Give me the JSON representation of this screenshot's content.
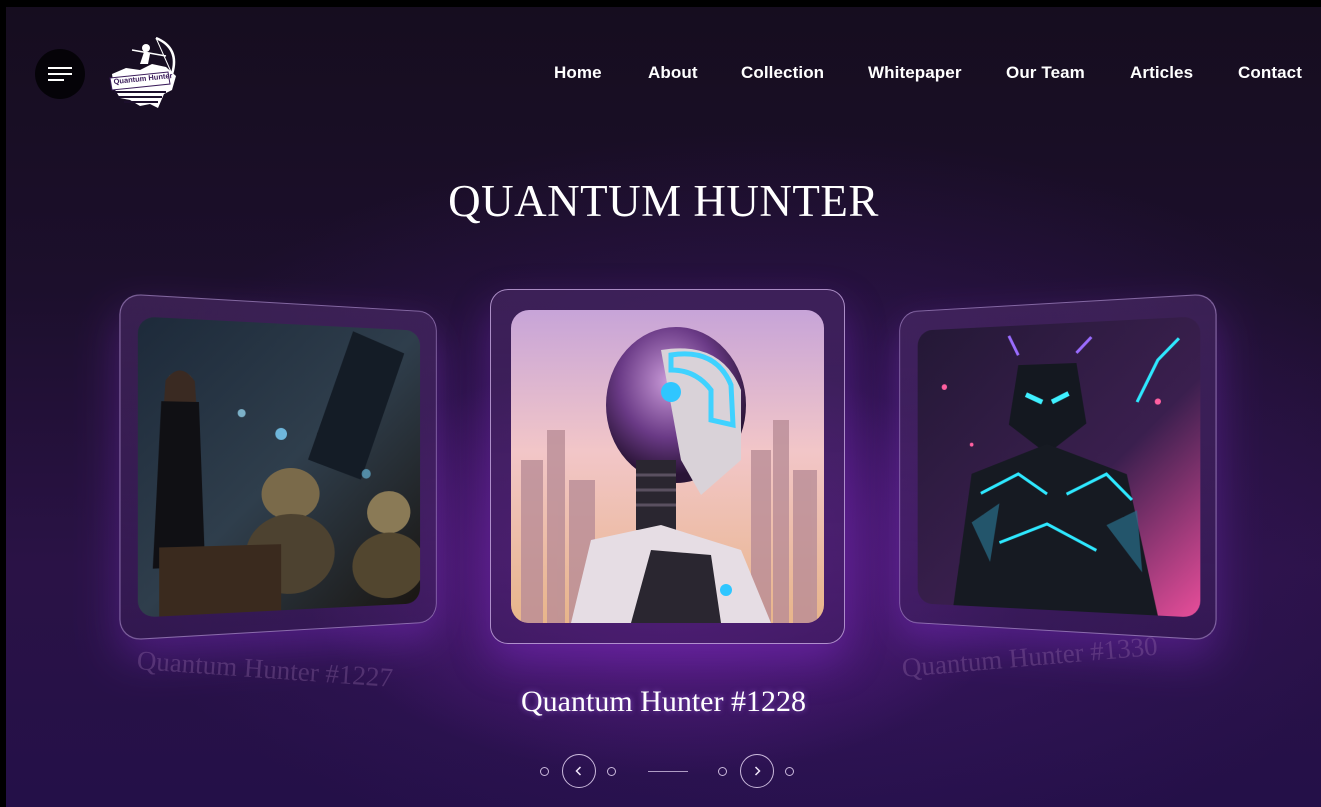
{
  "header": {
    "menu_icon": "hamburger-menu-icon",
    "logo": {
      "text": "Quantum Hunter",
      "icon": "archer-logo-icon"
    },
    "nav": [
      {
        "label": "Home"
      },
      {
        "label": "About"
      },
      {
        "label": "Collection"
      },
      {
        "label": "Whitepaper"
      },
      {
        "label": "Our Team"
      },
      {
        "label": "Articles"
      },
      {
        "label": "Contact"
      }
    ]
  },
  "hero": {
    "title": "QUANTUM HUNTER"
  },
  "carousel": {
    "cards": [
      {
        "caption": "Quantum Hunter #1227",
        "image": "hunter-with-goblins-image"
      },
      {
        "caption": "Quantum Hunter #1228",
        "image": "robot-helmet-image"
      },
      {
        "caption": "Quantum Hunter #1330",
        "image": "neon-armored-warrior-image"
      }
    ],
    "prev_icon": "chevron-left-icon",
    "next_icon": "chevron-right-icon"
  },
  "colors": {
    "background_dark": "#160d1f",
    "background_purple": "#2a1246",
    "accent_glow": "#8a28be",
    "text": "#ffffff"
  }
}
